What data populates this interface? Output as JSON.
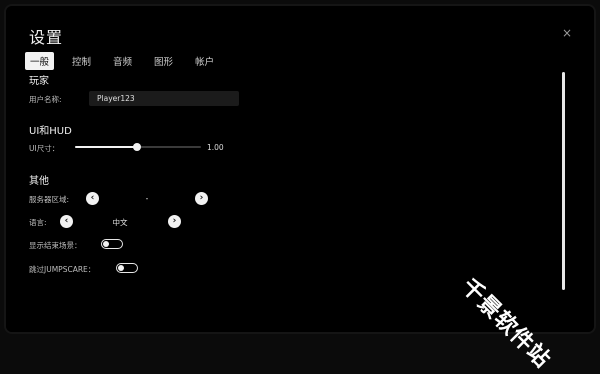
{
  "window": {
    "title": "设置",
    "close_symbol": "×"
  },
  "tabs": [
    {
      "label": "一般",
      "active": true
    },
    {
      "label": "控制",
      "active": false
    },
    {
      "label": "音频",
      "active": false
    },
    {
      "label": "图形",
      "active": false
    },
    {
      "label": "帐户",
      "active": false
    }
  ],
  "player": {
    "section_title": "玩家",
    "username_label": "用户名称:",
    "username_value": "Player123"
  },
  "ui_hud": {
    "section_title": "UI和HUD",
    "ui_size_label": "UI尺寸：",
    "ui_size_value": "1.00",
    "ui_size_fraction": 0.49
  },
  "other": {
    "section_title": "其他",
    "server_region_label": "服务器区域:",
    "server_region_value": "-",
    "language_label": "语言:",
    "language_value": "中文",
    "show_end_scene_label": "显示结束场景：",
    "show_end_scene_on": false,
    "skip_jumpscare_label": "跳过JUMPSCARE：",
    "skip_jumpscare_on": false
  },
  "icons": {
    "prev": "‹",
    "next": "›"
  },
  "watermark": "千景软件站",
  "colors": {
    "background": "#000000",
    "accent": "#f2f2f2",
    "input_bg": "#1b1b1b"
  }
}
